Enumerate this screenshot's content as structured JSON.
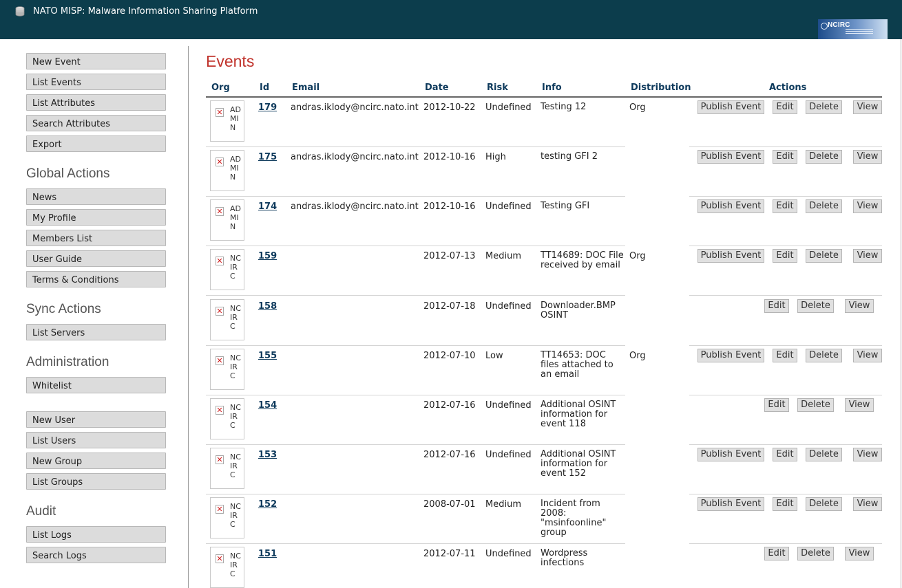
{
  "header": {
    "app_title": "NATO MISP: Malware Information Sharing Platform",
    "logo_text": "NCIRC"
  },
  "sidebar": {
    "top_items": [
      "New Event",
      "List Events",
      "List Attributes",
      "Search Attributes",
      "Export"
    ],
    "global_heading": "Global Actions",
    "global_items": [
      "News",
      "My Profile",
      "Members List",
      "User Guide",
      "Terms & Conditions"
    ],
    "sync_heading": "Sync Actions",
    "sync_items": [
      "List Servers"
    ],
    "admin_heading": "Administration",
    "admin_items": [
      "Whitelist"
    ],
    "user_items": [
      "New User",
      "List Users",
      "New Group",
      "List Groups"
    ],
    "audit_heading": "Audit",
    "audit_items": [
      "List Logs",
      "Search Logs"
    ]
  },
  "main": {
    "title": "Events",
    "columns": {
      "org": "Org",
      "id": "Id",
      "email": "Email",
      "date": "Date",
      "risk": "Risk",
      "info": "Info",
      "distribution": "Distribution",
      "actions": "Actions"
    },
    "action_labels": {
      "publish": "Publish Event",
      "edit": "Edit",
      "delete": "Delete",
      "view": "View"
    },
    "events": [
      {
        "org": "ADMIN",
        "id": "179",
        "email": "andras.iklody@ncirc.nato.int",
        "date": "2012-10-22",
        "risk": "Undefined",
        "info": "Testing 12",
        "distribution": "Org",
        "publish": true
      },
      {
        "org": "ADMIN",
        "id": "175",
        "email": "andras.iklody@ncirc.nato.int",
        "date": "2012-10-16",
        "risk": "High",
        "info": "testing GFI 2",
        "distribution": "",
        "publish": true
      },
      {
        "org": "ADMIN",
        "id": "174",
        "email": "andras.iklody@ncirc.nato.int",
        "date": "2012-10-16",
        "risk": "Undefined",
        "info": "Testing GFI",
        "distribution": "",
        "publish": true
      },
      {
        "org": "NCIRC",
        "id": "159",
        "email": "",
        "date": "2012-07-13",
        "risk": "Medium",
        "info": "TT14689: DOC File received by email",
        "distribution": "Org",
        "publish": true
      },
      {
        "org": "NCIRC",
        "id": "158",
        "email": "",
        "date": "2012-07-18",
        "risk": "Undefined",
        "info": "Downloader.BMP OSINT",
        "distribution": "",
        "publish": false
      },
      {
        "org": "NCIRC",
        "id": "155",
        "email": "",
        "date": "2012-07-10",
        "risk": "Low",
        "info": "TT14653: DOC files attached to an email",
        "distribution": "Org",
        "publish": true
      },
      {
        "org": "NCIRC",
        "id": "154",
        "email": "",
        "date": "2012-07-16",
        "risk": "Undefined",
        "info": "Additional OSINT information for event 118",
        "distribution": "",
        "publish": false
      },
      {
        "org": "NCIRC",
        "id": "153",
        "email": "",
        "date": "2012-07-16",
        "risk": "Undefined",
        "info": "Additional OSINT information for event 152",
        "distribution": "",
        "publish": true
      },
      {
        "org": "NCIRC",
        "id": "152",
        "email": "",
        "date": "2008-07-01",
        "risk": "Medium",
        "info": "Incident from 2008: \"msinfoonline\" group",
        "distribution": "",
        "publish": true
      },
      {
        "org": "NCIRC",
        "id": "151",
        "email": "",
        "date": "2012-07-11",
        "risk": "Undefined",
        "info": "Wordpress infections",
        "distribution": "",
        "publish": false
      }
    ]
  },
  "colors": {
    "topbar": "#0c3d4c",
    "title_red": "#c0322b",
    "header_blue": "#0e3a5c",
    "button_bg": "#dcdcdc"
  }
}
